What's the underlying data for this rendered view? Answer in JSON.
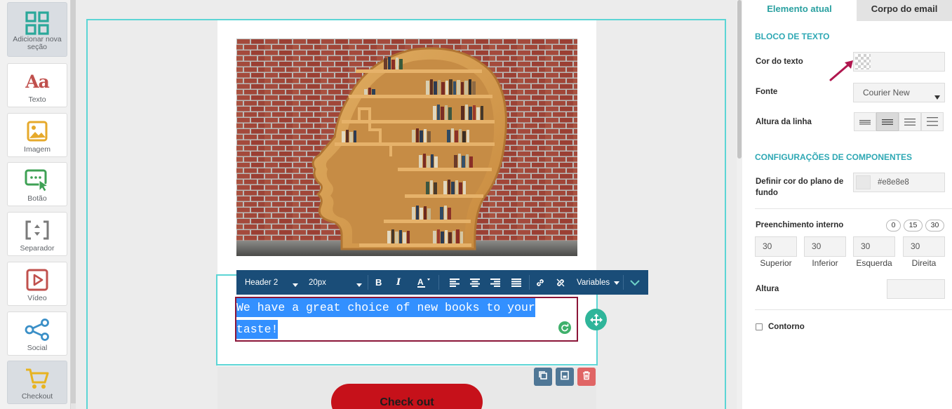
{
  "sidebar": {
    "tools": [
      {
        "label": "Adicionar nova seção",
        "icon": "grid-icon"
      },
      {
        "label": "Texto",
        "icon": "text-aa-icon"
      },
      {
        "label": "Imagem",
        "icon": "image-icon"
      },
      {
        "label": "Botão",
        "icon": "button-cursor-icon"
      },
      {
        "label": "Separador",
        "icon": "separator-icon"
      },
      {
        "label": "Vídeo",
        "icon": "video-play-icon"
      },
      {
        "label": "Social",
        "icon": "share-icon"
      },
      {
        "label": "Checkout",
        "icon": "cart-icon"
      }
    ]
  },
  "editor": {
    "toolbar": {
      "style_select": "Header 2",
      "size_select": "20px",
      "variables_label": "Variables"
    },
    "text_lines": [
      "We have a great choice of new books to your",
      "taste!"
    ],
    "checkout_label": "Check out"
  },
  "panel": {
    "tabs": [
      {
        "label": "Elemento atual",
        "active": true
      },
      {
        "label": "Corpo do email",
        "active": false
      }
    ],
    "text_block_title": "BLOCO DE TEXTO",
    "text_color_label": "Cor do texto",
    "font_label": "Fonte",
    "font_value": "Courier New",
    "line_height_label": "Altura da linha",
    "component_title": "CONFIGURAÇÕES DE COMPONENTES",
    "bg_color_label": "Definir cor do plano de fundo",
    "bg_color_value": "#e8e8e8",
    "padding_label": "Preenchimento interno",
    "padding_presets": [
      "0",
      "15",
      "30"
    ],
    "padding": [
      {
        "value": "30",
        "label": "Superior"
      },
      {
        "value": "30",
        "label": "Inferior"
      },
      {
        "value": "30",
        "label": "Esquerda"
      },
      {
        "value": "30",
        "label": "Direita"
      }
    ],
    "height_label": "Altura",
    "border_label": "Contorno"
  },
  "colors": {
    "accent": "#2ea8b4",
    "toolbar": "#1a4d78",
    "checkout": "#c6111a",
    "selection": "#3390ff",
    "outline": "#5cd5d5"
  }
}
